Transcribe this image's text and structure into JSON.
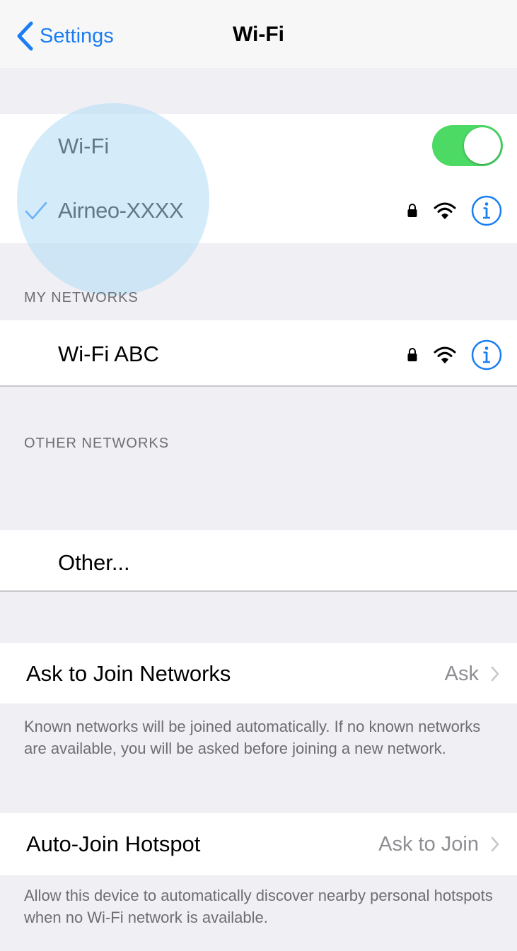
{
  "navbar": {
    "back_label": "Settings",
    "title": "Wi-Fi"
  },
  "wifi": {
    "label": "Wi-Fi",
    "toggle_on": true,
    "connected_network": "Airneo-XXXX"
  },
  "my_networks": {
    "header": "MY NETWORKS",
    "items": [
      {
        "name": "Wi-Fi ABC"
      }
    ]
  },
  "other_networks": {
    "header": "OTHER NETWORKS",
    "other_label": "Other..."
  },
  "ask_to_join": {
    "label": "Ask to Join Networks",
    "value": "Ask",
    "footer": "Known networks will be joined automatically. If no known networks are available, you will be asked before joining a new network."
  },
  "auto_join_hotspot": {
    "label": "Auto-Join Hotspot",
    "value": "Ask to Join",
    "footer": "Allow this device to automatically discover nearby personal hotspots when no Wi-Fi network is available."
  },
  "colors": {
    "accent": "#1a7ef2",
    "toggle_on": "#4cd964",
    "background": "#efeff4",
    "secondary_text": "#6d6d72"
  }
}
